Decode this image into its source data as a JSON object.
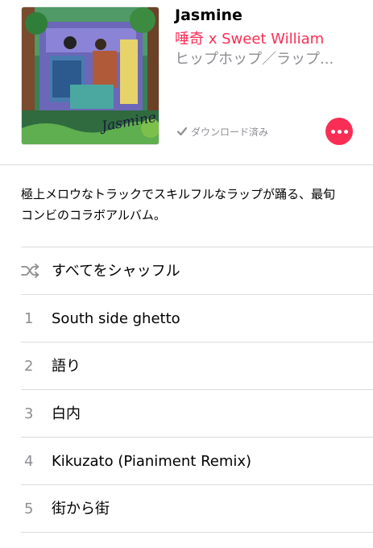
{
  "album": {
    "title": "Jasmine",
    "artist": "唾奇 x Sweet William",
    "genre": "ヒップホップ／ラップ...",
    "download_status": "ダウンロード済み",
    "artwork_text": "Jasmine"
  },
  "description": "極上メロウなトラックでスキルフルなラップが踊る、最旬コンビのコラボアルバム。",
  "shuffle_label": "すべてをシャッフル",
  "tracks": [
    {
      "number": "1",
      "title": "South side ghetto"
    },
    {
      "number": "2",
      "title": "語り"
    },
    {
      "number": "3",
      "title": "白内"
    },
    {
      "number": "4",
      "title": "Kikuzato (Pianiment Remix)"
    },
    {
      "number": "5",
      "title": "街から街"
    }
  ],
  "colors": {
    "accent": "#fa2d55",
    "secondary_text": "#8e8e93",
    "separator": "#dcdcdc"
  },
  "icons": {
    "download": "checkmark-icon",
    "more": "ellipsis-icon",
    "shuffle": "shuffle-icon"
  }
}
